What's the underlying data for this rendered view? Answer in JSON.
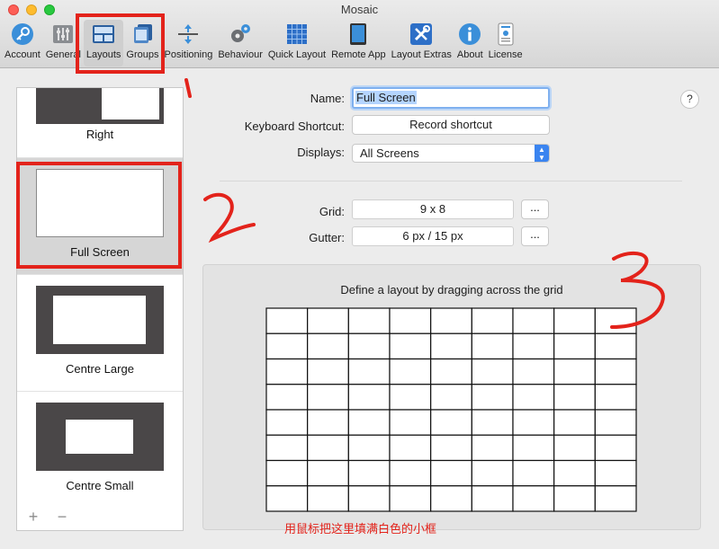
{
  "window": {
    "title": "Mosaic"
  },
  "toolbar": {
    "items": [
      {
        "label": "Account",
        "icon": "key-icon"
      },
      {
        "label": "General",
        "icon": "sliders-icon"
      },
      {
        "label": "Layouts",
        "icon": "layouts-icon",
        "active": true
      },
      {
        "label": "Groups",
        "icon": "groups-icon"
      },
      {
        "label": "Positioning",
        "icon": "positioning-icon"
      },
      {
        "label": "Behaviour",
        "icon": "gears-icon"
      },
      {
        "label": "Quick Layout",
        "icon": "quick-layout-icon"
      },
      {
        "label": "Remote App",
        "icon": "tablet-icon"
      },
      {
        "label": "Layout Extras",
        "icon": "tools-icon"
      },
      {
        "label": "About",
        "icon": "info-icon"
      },
      {
        "label": "License",
        "icon": "license-icon"
      }
    ]
  },
  "sidebar": {
    "layouts": [
      {
        "name": "Right"
      },
      {
        "name": "Full Screen",
        "selected": true
      },
      {
        "name": "Centre Large"
      },
      {
        "name": "Centre Small"
      }
    ],
    "add_icon": "+",
    "remove_icon": "−"
  },
  "form": {
    "name_label": "Name:",
    "name_value": "Full Screen",
    "shortcut_label": "Keyboard Shortcut:",
    "shortcut_button": "Record shortcut",
    "displays_label": "Displays:",
    "displays_value": "All Screens",
    "grid_label": "Grid:",
    "grid_value": "9 x 8",
    "grid_more": "...",
    "gutter_label": "Gutter:",
    "gutter_value": "6 px / 15 px",
    "gutter_more": "...",
    "help": "?"
  },
  "grid": {
    "caption": "Define a layout by dragging across the grid",
    "columns": 9,
    "rows": 8
  },
  "annotations": {
    "marks": [
      "1",
      "2",
      "3"
    ],
    "note": "用鼠标把这里填满白色的小框",
    "color": "#e3231b"
  }
}
